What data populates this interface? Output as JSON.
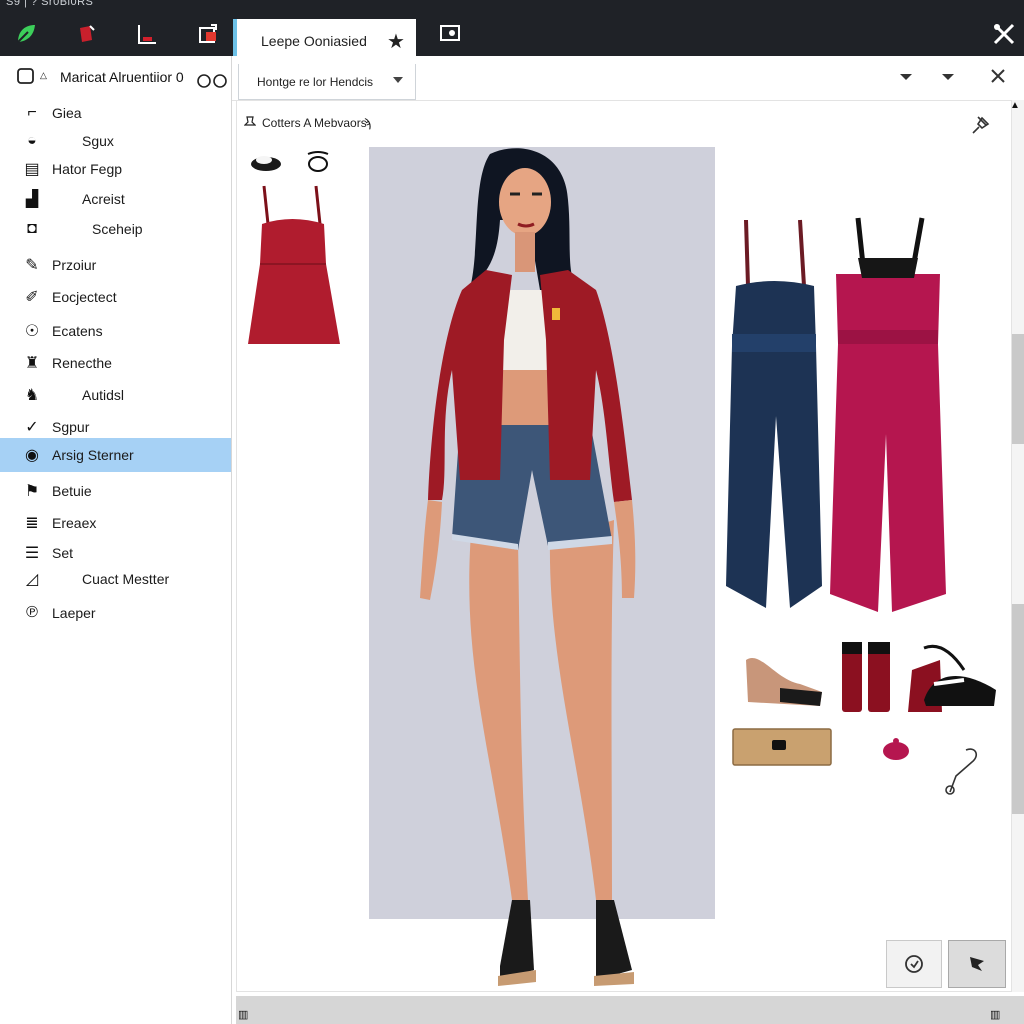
{
  "topbar": {
    "menu_text": "S9 | ? Sr0Bl0RS"
  },
  "tab": {
    "label": "Leepe Ooniasied"
  },
  "dropdown": {
    "label": "Hontge re lor Hendcis"
  },
  "panel": {
    "title": "Cotters A Mebvaors"
  },
  "sidebar": {
    "header": "Maricat Alruentiior 0",
    "items": [
      {
        "label": "Giea",
        "icon": "glasses-icon"
      },
      {
        "label": "Sgux",
        "icon": "hat-icon"
      },
      {
        "label": "Hator Fegp",
        "icon": "shirt-icon"
      },
      {
        "label": "Acreist",
        "icon": "boots-icon"
      },
      {
        "label": "Sceheip",
        "icon": "bag-icon"
      },
      {
        "label": "Przoiur",
        "icon": "brush-icon"
      },
      {
        "label": "Eocjectect",
        "icon": "pencil-icon"
      },
      {
        "label": "Ecatens",
        "icon": "skull-icon"
      },
      {
        "label": "Renecthe",
        "icon": "figure-icon"
      },
      {
        "label": "Autidsl",
        "icon": "figure-pair-icon"
      },
      {
        "label": "Sgpur",
        "icon": "check-icon"
      },
      {
        "label": "Arsig Sterner",
        "icon": "compass-icon",
        "selected": true
      },
      {
        "label": "Betuie",
        "icon": "flag-icon"
      },
      {
        "label": "Ereaex",
        "icon": "stripes-icon"
      },
      {
        "label": "Set",
        "icon": "lines-icon"
      },
      {
        "label": "Cuact Mestter",
        "icon": "sneaker-icon"
      },
      {
        "label": "Laeper",
        "icon": "p-icon"
      }
    ]
  },
  "colors": {
    "toolbar_bg": "#1f2227",
    "selection": "#a6d1f5",
    "tab_accent": "#6ec2e8",
    "preview_bg": "#cfd0db",
    "jacket": "#9e1a25",
    "dress": "#b01c2e",
    "jumpsuit_navy": "#1d3354",
    "jumpsuit_magenta": "#b5164f"
  }
}
